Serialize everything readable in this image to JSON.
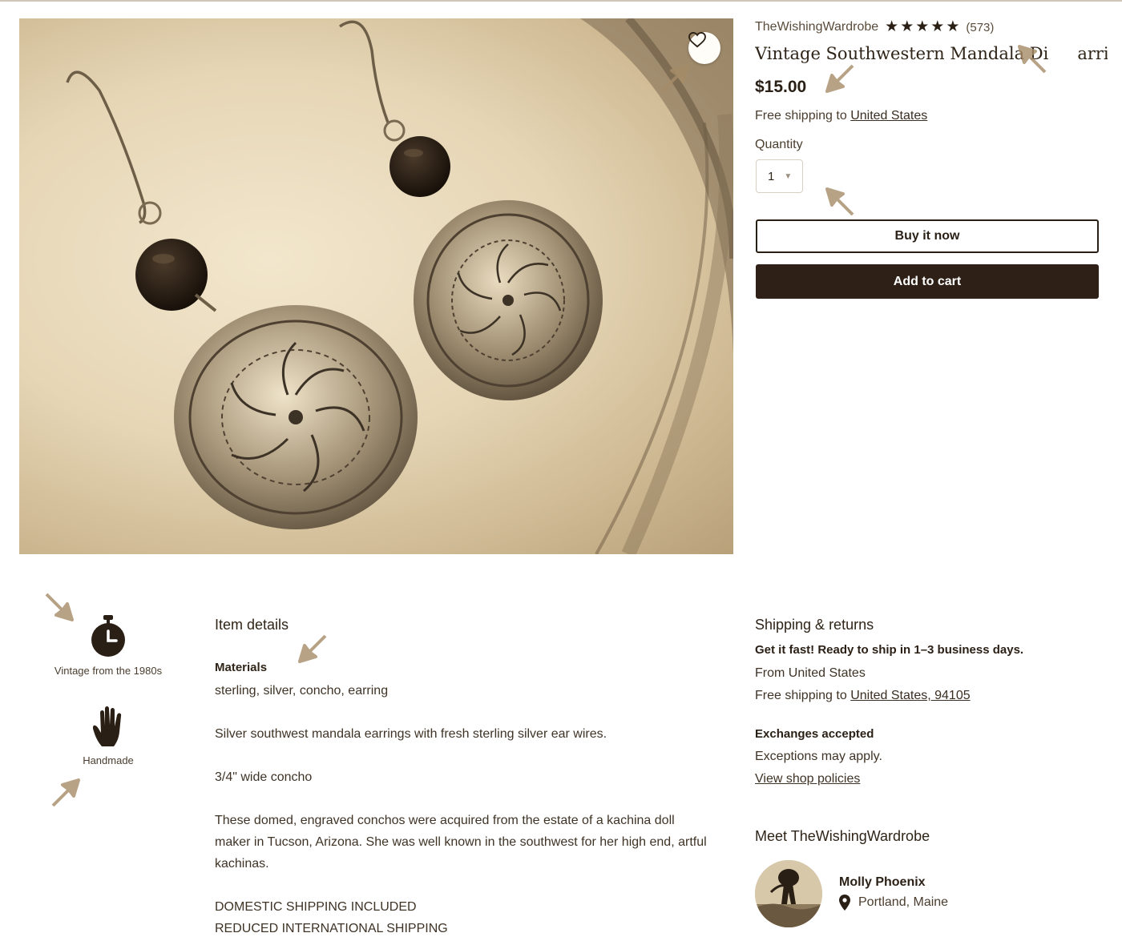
{
  "colors": {
    "text_dark": "#2a1f15",
    "cart_button": "#2e2016",
    "arrow_marks": "#a68c68"
  },
  "listing": {
    "shop_name": "TheWishingWardrobe",
    "rating_stars": 5,
    "review_count": "(573)",
    "title": "Vintage Southwestern Mandala Di",
    "title_tail": "arrings",
    "price": "$15.00",
    "free_shipping_prefix": "Free shipping to ",
    "free_shipping_country": "United States",
    "quantity_label": "Quantity",
    "quantity_value": "1",
    "buy_now_label": "Buy it now",
    "add_to_cart_label": "Add to cart",
    "favorite_icon": "heart-icon"
  },
  "highlights": [
    {
      "icon": "stopwatch-icon",
      "label": "Vintage from the 1980s"
    },
    {
      "icon": "hand-icon",
      "label": "Handmade"
    }
  ],
  "item_details": {
    "title": "Item details",
    "materials_label": "Materials",
    "materials": "sterling, silver, concho, earring",
    "paragraphs": [
      "Silver southwest mandala earrings with fresh sterling silver ear wires.",
      "3/4\" wide concho",
      "These domed, engraved conchos were acquired from the estate of a kachina doll maker in Tucson, Arizona. She was well known in the southwest for her high end, artful kachinas.",
      "DOMESTIC SHIPPING INCLUDED",
      "REDUCED INTERNATIONAL SHIPPING"
    ]
  },
  "shipping": {
    "title": "Shipping & returns",
    "ready_to_ship": "Get it fast! Ready to ship in 1–3 business days.",
    "from": "From United States",
    "free_shipping_prefix": "Free shipping to ",
    "free_shipping_link": "United States, 94105",
    "exchanges_title": "Exchanges accepted",
    "exceptions": "Exceptions may apply.",
    "policies_link": "View shop policies"
  },
  "meet": {
    "title": "Meet TheWishingWardrobe",
    "owner_name": "Molly Phoenix",
    "location": "Portland, Maine",
    "location_icon": "map-pin-icon"
  }
}
